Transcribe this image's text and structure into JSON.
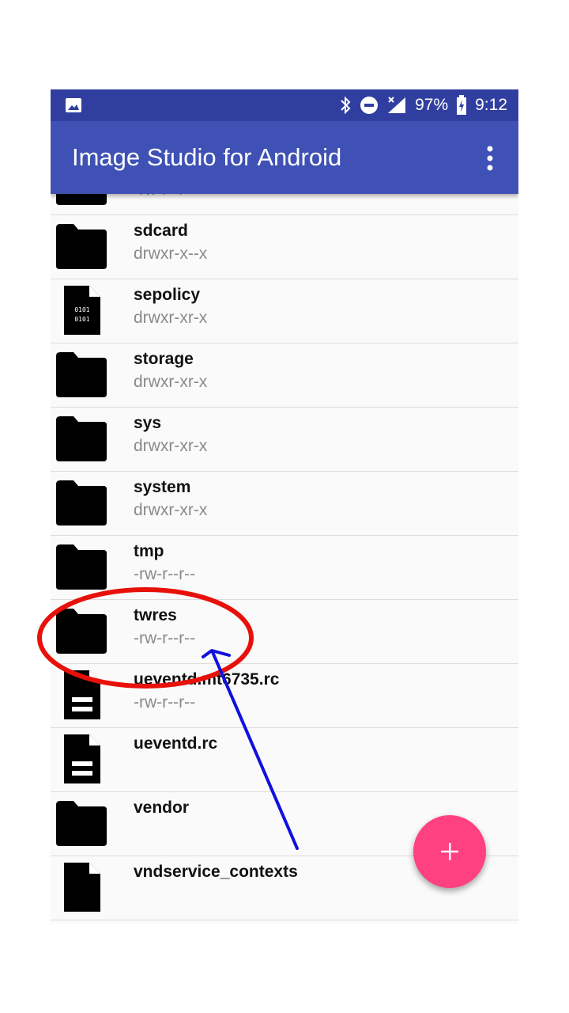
{
  "status_bar": {
    "battery": "97%",
    "time": "9:12",
    "icons": [
      "image-icon",
      "bluetooth-icon",
      "do-not-disturb-icon",
      "signal-icon",
      "battery-charging-icon"
    ]
  },
  "app_bar": {
    "title": "Image Studio for Android",
    "menu_icon": "more-vert-icon",
    "color": "#3F51B5"
  },
  "files": [
    {
      "name": "",
      "perm": "-rw-r--r--",
      "type": "folder"
    },
    {
      "name": "sdcard",
      "perm": "drwxr-x--x",
      "type": "folder"
    },
    {
      "name": "sepolicy",
      "perm": "drwxr-xr-x",
      "type": "binary"
    },
    {
      "name": "storage",
      "perm": "drwxr-xr-x",
      "type": "folder"
    },
    {
      "name": "sys",
      "perm": "drwxr-xr-x",
      "type": "folder"
    },
    {
      "name": "system",
      "perm": "drwxr-xr-x",
      "type": "folder"
    },
    {
      "name": "tmp",
      "perm": "-rw-r--r--",
      "type": "folder"
    },
    {
      "name": "twres",
      "perm": "-rw-r--r--",
      "type": "folder"
    },
    {
      "name": "ueventd.mt6735.rc",
      "perm": "-rw-r--r--",
      "type": "text"
    },
    {
      "name": "ueventd.rc",
      "perm": "",
      "type": "text"
    },
    {
      "name": "vendor",
      "perm": "",
      "type": "folder"
    },
    {
      "name": "vndservice_contexts",
      "perm": "",
      "type": "file"
    }
  ],
  "fab": {
    "icon": "plus-icon",
    "color": "#FF4081"
  },
  "annotations": {
    "circle_color": "#E8100A",
    "arrow_color": "#1010E0"
  }
}
